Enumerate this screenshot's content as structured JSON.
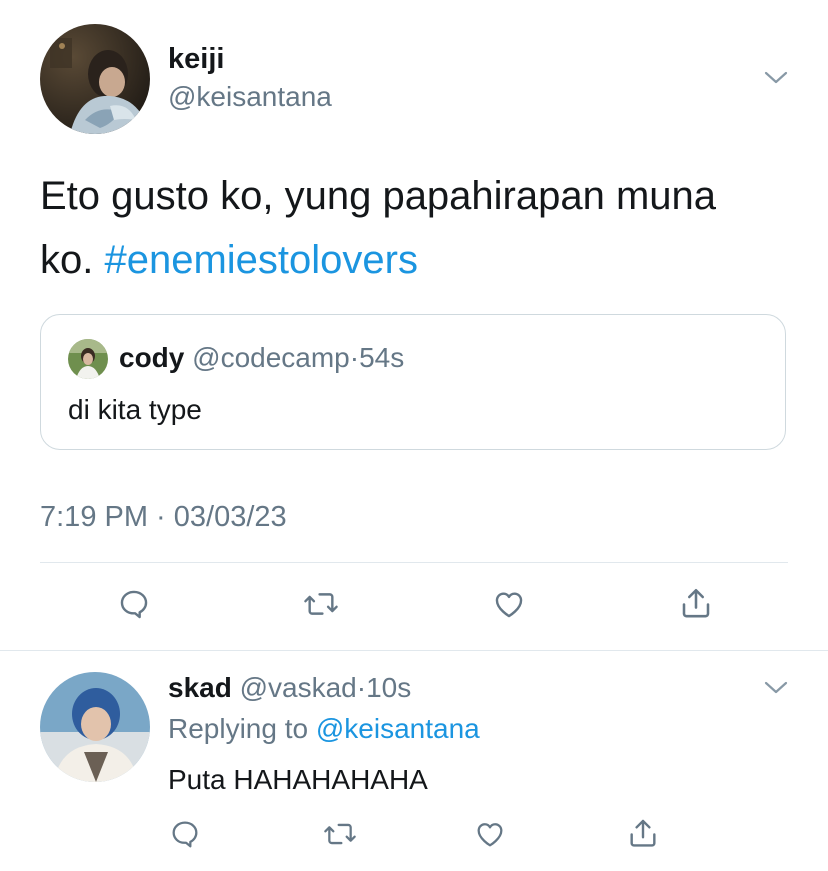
{
  "tweet": {
    "author_name": "keiji",
    "author_handle": "@keisantana",
    "text_line1": "Eto gusto ko, yung papahirapan muna",
    "text_line2": "ko.",
    "hashtag": "#enemiestolovers",
    "timestamp": "7:19 PM · 03/03/23",
    "quoted": {
      "author_name": "cody",
      "author_handle": "@codecamp",
      "time": "·54s",
      "text": "di kita type"
    },
    "actions": [
      "reply-icon",
      "retweet-icon",
      "like-icon",
      "share-icon"
    ]
  },
  "reply": {
    "author_name": "skad",
    "author_handle": "@vaskad",
    "time": "·10s",
    "replying_prefix": "Replying to",
    "replying_handle": "@keisantana",
    "text": "Puta HAHAHAHAHA",
    "actions": [
      "reply-icon",
      "retweet-icon",
      "like-icon",
      "share-icon"
    ]
  },
  "colors": {
    "link_blue": "#1b95e0",
    "secondary_gray": "#657786",
    "divider": "#e1e8ed"
  }
}
